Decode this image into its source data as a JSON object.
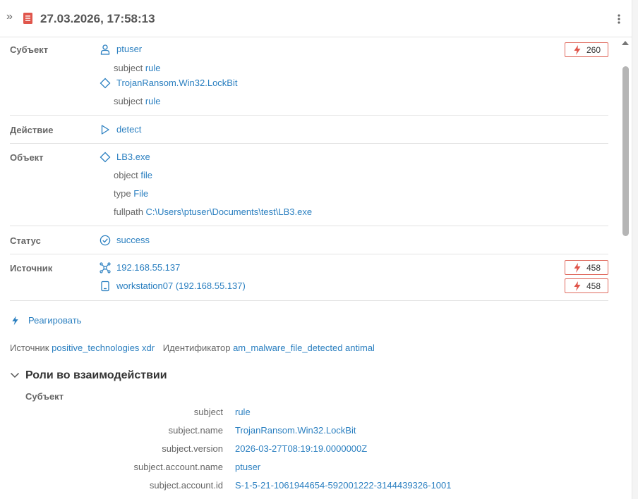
{
  "header": {
    "expand_glyph": "»",
    "title": "27.03.2026, 17:58:13",
    "doc_icon": "document-icon",
    "menu_icon": "kebab-menu-icon"
  },
  "colors": {
    "accent": "#2a7fc0",
    "label": "#666666",
    "alert": "#e06b5f",
    "header_icon": "#e0564c"
  },
  "subject": {
    "label": "Субъект",
    "account": {
      "icon": "user-icon",
      "value": "ptuser"
    },
    "account_attr": {
      "key": "subject",
      "value": "rule"
    },
    "rule": {
      "icon": "diamond-icon",
      "value": "TrojanRansom.Win32.LockBit"
    },
    "rule_attr": {
      "key": "subject",
      "value": "rule"
    },
    "badge": {
      "icon": "lightning-icon",
      "count": "260"
    }
  },
  "action": {
    "label": "Действие",
    "icon": "play-icon",
    "value": "detect"
  },
  "object": {
    "label": "Объект",
    "icon": "diamond-icon",
    "value": "LB3.exe",
    "attrs": [
      {
        "key": "object",
        "value": "file"
      },
      {
        "key": "type",
        "value": "File"
      },
      {
        "key": "fullpath",
        "value": "C:\\Users\\ptuser\\Documents\\test\\LB3.exe"
      }
    ]
  },
  "status": {
    "label": "Статус",
    "icon": "check-circle-icon",
    "value": "success"
  },
  "source": {
    "label": "Источник",
    "ip": {
      "icon": "network-icon",
      "value": "192.168.55.137",
      "badge": "458"
    },
    "host": {
      "icon": "device-icon",
      "value": "workstation07 (192.168.55.137)",
      "badge": "458"
    }
  },
  "respond": {
    "icon": "lightning-icon",
    "label": "Реагировать"
  },
  "meta": {
    "source_key": "Источник",
    "source_value": "positive_technologies xdr",
    "id_key": "Идентификатор",
    "id_value": "am_malware_file_detected antimal"
  },
  "roles": {
    "title": "Роли во взаимодействии",
    "subtitle": "Субъект",
    "rows": [
      {
        "key": "subject",
        "value": "rule"
      },
      {
        "key": "subject.name",
        "value": "TrojanRansom.Win32.LockBit"
      },
      {
        "key": "subject.version",
        "value": "2026-03-27T08:19:19.0000000Z"
      },
      {
        "key": "subject.account.name",
        "value": "ptuser"
      },
      {
        "key": "subject.account.id",
        "value": "S-1-5-21-1061944654-592001222-3144439326-1001"
      }
    ]
  }
}
